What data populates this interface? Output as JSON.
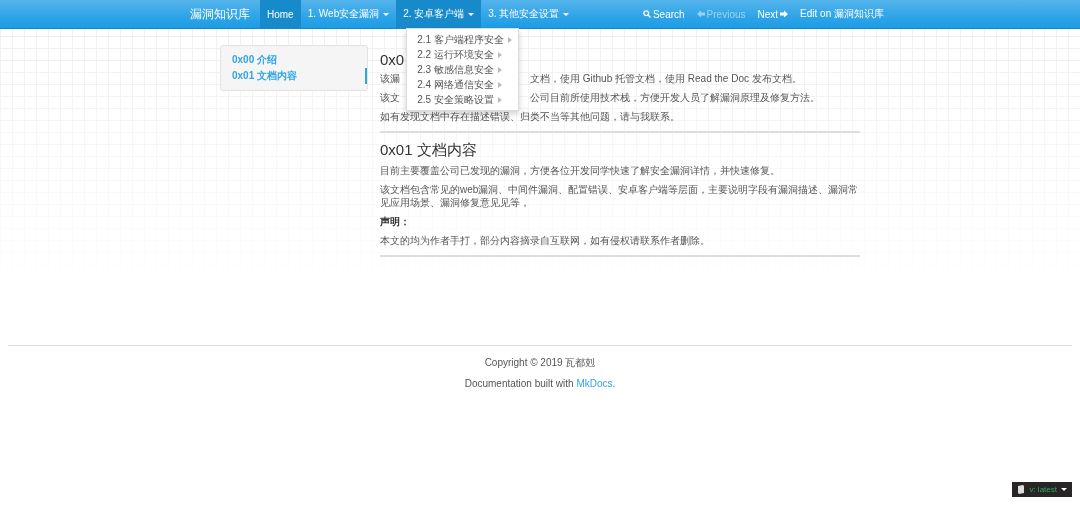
{
  "navbar": {
    "brand": "漏洞知识库",
    "items": [
      {
        "label": "Home",
        "selected": true,
        "dropdown": false,
        "expanded": false
      },
      {
        "label": "1. Web安全漏洞",
        "selected": false,
        "dropdown": true,
        "expanded": false
      },
      {
        "label": "2. 安卓客户端",
        "selected": false,
        "dropdown": true,
        "expanded": true,
        "menu": [
          "2.1 客户端程序安全",
          "2.2 运行环境安全",
          "2.3 敏感信息安全",
          "2.4 网络通信安全",
          "2.5 安全策略设置"
        ]
      },
      {
        "label": "3. 其他安全设置",
        "selected": false,
        "dropdown": true,
        "expanded": false
      }
    ],
    "right": [
      {
        "kind": "search",
        "label": "Search",
        "disabled": false
      },
      {
        "kind": "previous",
        "label": "Previous",
        "disabled": true
      },
      {
        "kind": "next",
        "label": "Next",
        "disabled": false
      },
      {
        "kind": "edit",
        "label": "Edit on 漏洞知识库",
        "disabled": false
      }
    ]
  },
  "sidebar": {
    "items": [
      {
        "label": "0x00 介绍",
        "selected": false
      },
      {
        "label": "0x01 文档内容",
        "selected": true
      }
    ]
  },
  "content": {
    "section_1": {
      "heading": "0x0",
      "lines": [
        {
          "left": "该漏",
          "right": "文档，使用 Github 托管文档，使用 Read the Doc 发布文档。"
        },
        {
          "left": "该文",
          "right": "公司目前所使用技术栈，方便开发人员了解漏洞原理及修复方法。"
        }
      ],
      "paragraph": "如有发现文档中存在描述错误、归类不当等其他问题，请与我联系。"
    },
    "section_2": {
      "heading": "0x01 文档内容",
      "paragraphs": [
        {
          "kind": "text",
          "text": "目前主要覆盖公司已发现的漏洞，方便各位开发同学快速了解安全漏洞详情，并快速修复。"
        },
        {
          "kind": "text",
          "text": "该文档包含常见的web漏洞、中间件漏洞、配置错误、安卓客户端等层面，主要说明字段有漏洞描述、漏洞常见应用场景、漏洞修复意见见等，"
        },
        {
          "kind": "label",
          "text": "声明："
        },
        {
          "kind": "text",
          "text": "本文的均为作者手打，部分内容摘录自互联网，如有侵权请联系作者删除。"
        }
      ]
    }
  },
  "footer": {
    "copyright": "Copyright © 2019 瓦都剋",
    "built_with": "Documentation built with",
    "link": "MkDocs",
    "after_link": "."
  },
  "version_badge": {
    "label": "v: latest"
  }
}
